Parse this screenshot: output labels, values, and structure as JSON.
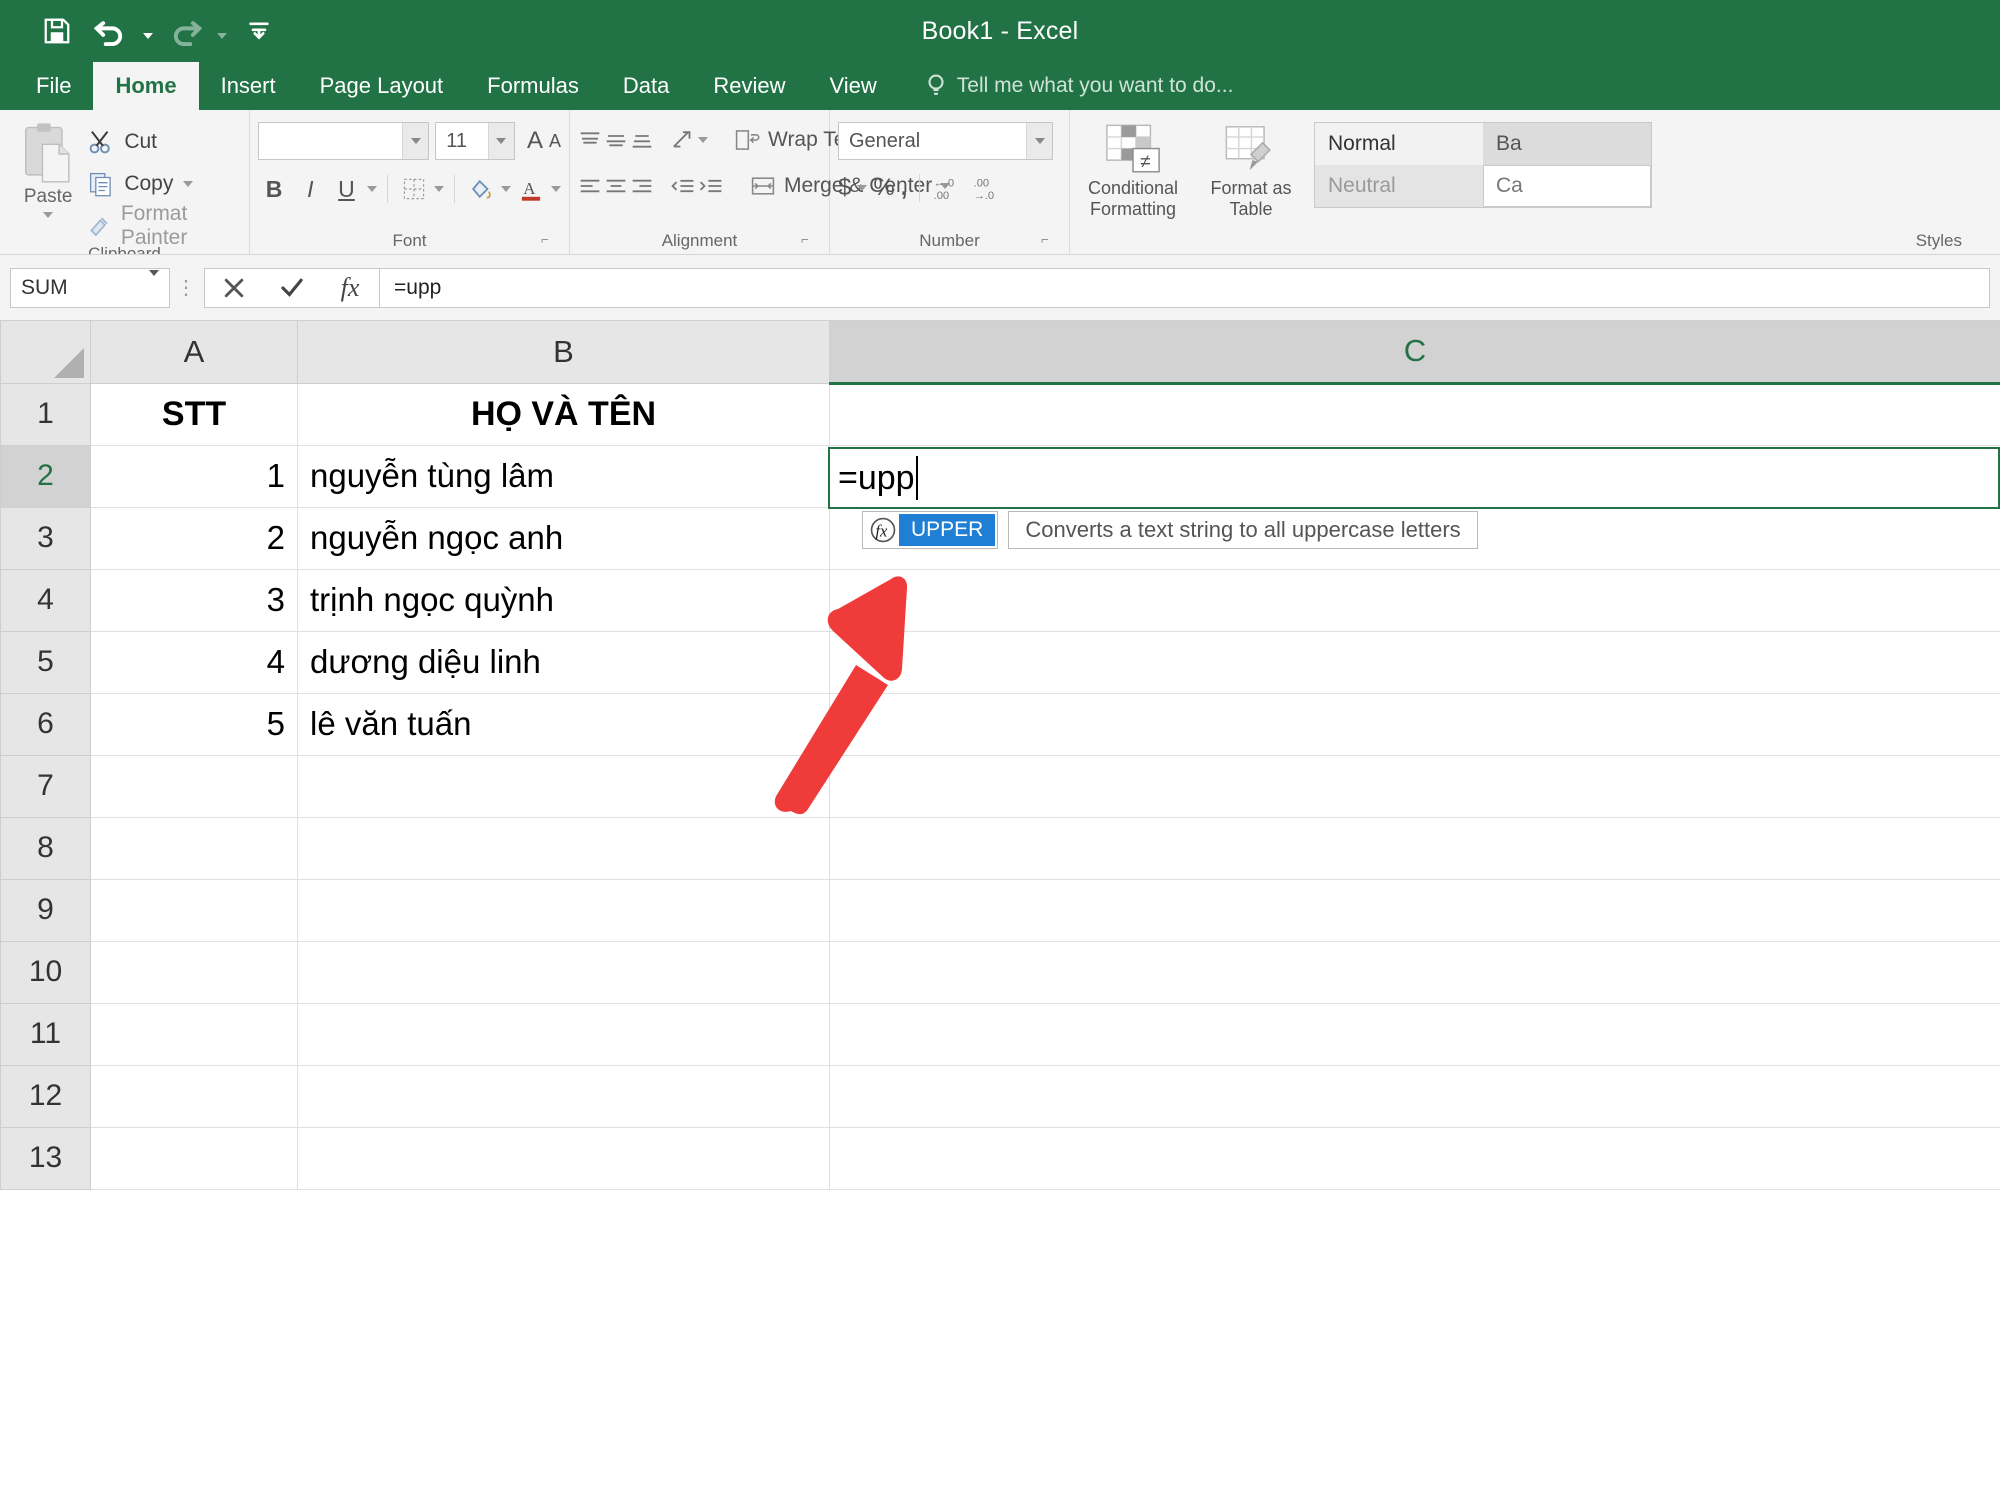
{
  "window": {
    "title": "Book1 - Excel"
  },
  "quick_access": {
    "save": "save-icon",
    "undo": "undo-icon",
    "redo": "redo-icon",
    "customize": "customize-toolbar-icon"
  },
  "tabs": [
    {
      "label": "File",
      "active": false
    },
    {
      "label": "Home",
      "active": true
    },
    {
      "label": "Insert",
      "active": false
    },
    {
      "label": "Page Layout",
      "active": false
    },
    {
      "label": "Formulas",
      "active": false
    },
    {
      "label": "Data",
      "active": false
    },
    {
      "label": "Review",
      "active": false
    },
    {
      "label": "View",
      "active": false
    }
  ],
  "tell_me": "Tell me what you want to do...",
  "ribbon": {
    "clipboard": {
      "label": "Clipboard",
      "paste": "Paste",
      "cut": "Cut",
      "copy": "Copy",
      "format_painter": "Format Painter"
    },
    "font": {
      "label": "Font",
      "font_name": "",
      "font_size": "11",
      "bold": "B",
      "italic": "I",
      "underline": "U",
      "grow_font": "A",
      "shrink_font": "A"
    },
    "alignment": {
      "label": "Alignment",
      "wrap_text": "Wrap Text",
      "merge_center": "Merge & Center"
    },
    "number": {
      "label": "Number",
      "format": "General",
      "currency": "$",
      "percent": "%",
      "comma": ","
    },
    "styles": {
      "label": "Styles",
      "conditional_formatting": "Conditional Formatting",
      "format_as_table": "Format as Table",
      "gallery": [
        "Normal",
        "Neutral",
        "Ba",
        "Ca"
      ]
    }
  },
  "formula_bar": {
    "name_box": "SUM",
    "cancel": "cancel-icon",
    "enter": "enter-icon",
    "insert_function": "fx",
    "formula": "=upp"
  },
  "sheet": {
    "columns": [
      "A",
      "B",
      "C"
    ],
    "selected_column": "C",
    "selected_row": "2",
    "rows": [
      {
        "num": "1",
        "a": "STT",
        "b": "HỌ VÀ TÊN",
        "c": "",
        "header": true
      },
      {
        "num": "2",
        "a": "1",
        "b": "nguyễn tùng lâm",
        "c": ""
      },
      {
        "num": "3",
        "a": "2",
        "b": "nguyễn ngọc anh",
        "c": ""
      },
      {
        "num": "4",
        "a": "3",
        "b": "trịnh ngọc quỳnh",
        "c": ""
      },
      {
        "num": "5",
        "a": "4",
        "b": "dương diệu linh",
        "c": ""
      },
      {
        "num": "6",
        "a": "5",
        "b": "lê văn tuấn",
        "c": ""
      },
      {
        "num": "7",
        "a": "",
        "b": "",
        "c": ""
      },
      {
        "num": "8",
        "a": "",
        "b": "",
        "c": ""
      },
      {
        "num": "9",
        "a": "",
        "b": "",
        "c": ""
      },
      {
        "num": "10",
        "a": "",
        "b": "",
        "c": ""
      },
      {
        "num": "11",
        "a": "",
        "b": "",
        "c": ""
      },
      {
        "num": "12",
        "a": "",
        "b": "",
        "c": ""
      },
      {
        "num": "13",
        "a": "",
        "b": "",
        "c": ""
      }
    ]
  },
  "active_cell": {
    "text": "=upp"
  },
  "autocomplete": {
    "function_name": "UPPER",
    "description": "Converts a text string to all uppercase letters",
    "icon": "fx-function-icon",
    "highlight_color": "#1e7fd4"
  },
  "annotation": {
    "arrow_color": "#F03B3B",
    "points_to": "UPPER"
  }
}
